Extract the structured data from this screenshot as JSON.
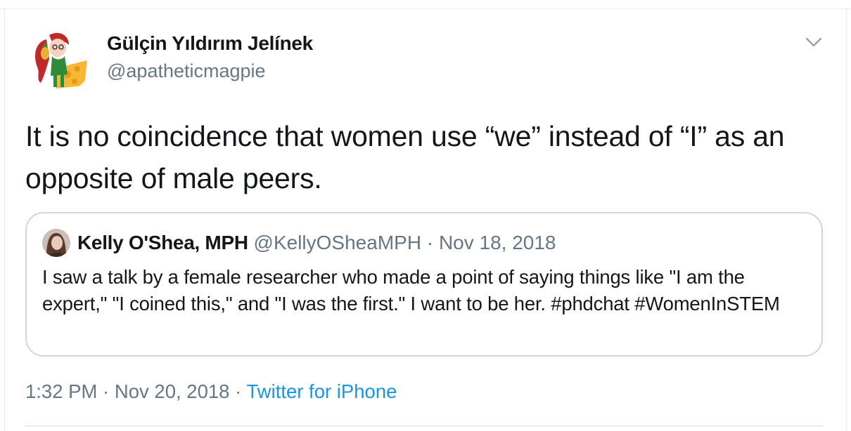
{
  "author": {
    "name": "Gülçin Yıldırım Jelínek",
    "handle": "@apatheticmagpie"
  },
  "icons": {
    "menu": "chevron-down-icon",
    "avatar": "avatar"
  },
  "tweet": {
    "text": "It is no coincidence that women use “we” instead of “I” as an opposite of male peers."
  },
  "quoted_tweet": {
    "name": "Kelly O'Shea, MPH",
    "handle": "@KellyOSheaMPH",
    "separator": "·",
    "date": "Nov 18, 2018",
    "text": "I saw a talk by a female researcher who made a point of saying things like \"I am the expert,\" \"I coined this,\" and \"I was the first.\" I want to be her. #phdchat #WomenInSTEM"
  },
  "meta": {
    "time": "1:32 PM",
    "separator1": "·",
    "date": "Nov 20, 2018",
    "separator2": "·",
    "source": "Twitter for iPhone"
  },
  "colors": {
    "text": "#14171a",
    "secondary": "#657786",
    "link": "#1b95e0",
    "border": "#ccd6dd"
  }
}
